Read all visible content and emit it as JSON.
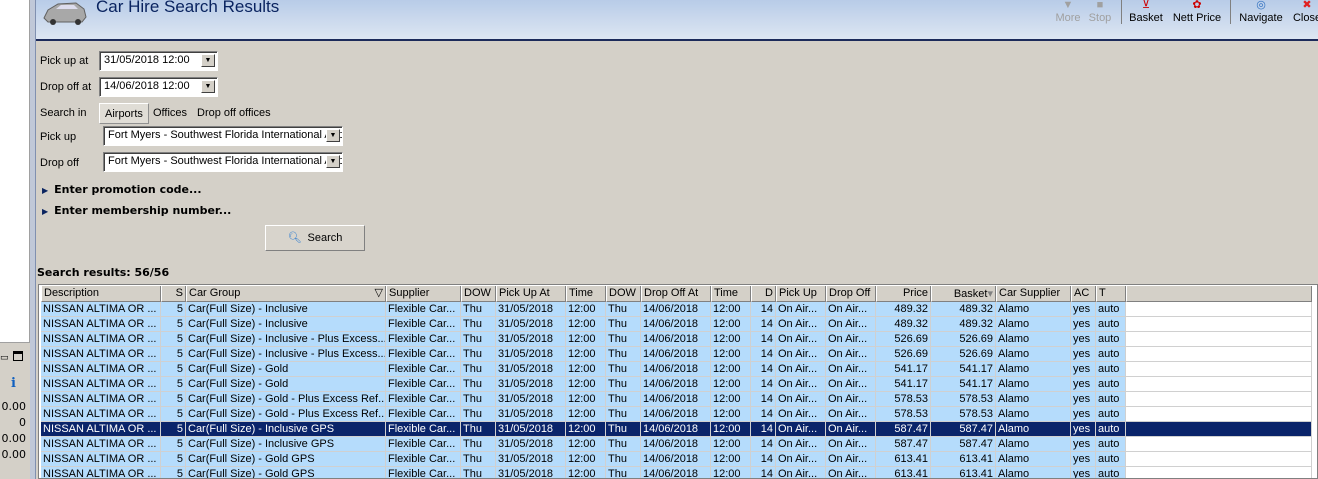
{
  "window": {
    "title": "Car Hire Search Results"
  },
  "toolbar": [
    {
      "label": "More",
      "icon": "more-icon",
      "enabled": false
    },
    {
      "label": "Stop",
      "icon": "stop-icon",
      "enabled": false
    },
    {
      "label": "Basket",
      "icon": "basket-icon",
      "enabled": true
    },
    {
      "label": "Nett Price",
      "icon": "nett-price-icon",
      "enabled": true
    },
    {
      "label": "Navigate",
      "icon": "navigate-icon",
      "enabled": true
    },
    {
      "label": "Close",
      "icon": "close-icon",
      "enabled": true
    }
  ],
  "form": {
    "pickup_at_label": "Pick up at",
    "pickup_at": "31/05/2018 12:00",
    "dropoff_at_label": "Drop off at",
    "dropoff_at": "14/06/2018 12:00",
    "search_in_label": "Search in",
    "search_in_tabs": [
      "Airports",
      "Offices",
      "Drop off offices"
    ],
    "pickup_label": "Pick up",
    "pickup": "Fort Myers - Southwest Florida International Airport",
    "dropoff_label": "Drop off",
    "dropoff": "Fort Myers - Southwest Florida International Airport",
    "promo": "Enter promotion code...",
    "membership": "Enter membership number...",
    "search_button": "Search"
  },
  "results": {
    "summary": "Search results: 56/56",
    "columns": [
      "Description",
      "S",
      "Car Group",
      "Supplier",
      "DOW",
      "Pick Up At",
      "Time",
      "DOW",
      "Drop Off At",
      "Time",
      "D",
      "Pick Up",
      "Drop Off",
      "Price",
      "Basket",
      "Car Supplier",
      "AC",
      "T"
    ],
    "selected_index": 8,
    "rows": [
      [
        "NISSAN ALTIMA OR ...",
        "5",
        "Car(Full Size) - Inclusive",
        "Flexible Car...",
        "Thu",
        "31/05/2018",
        "12:00",
        "Thu",
        "14/06/2018",
        "12:00",
        "14",
        "On Air...",
        "On Air...",
        "489.32",
        "489.32",
        "Alamo",
        "yes",
        "auto"
      ],
      [
        "NISSAN ALTIMA OR ...",
        "5",
        "Car(Full Size) - Inclusive",
        "Flexible Car...",
        "Thu",
        "31/05/2018",
        "12:00",
        "Thu",
        "14/06/2018",
        "12:00",
        "14",
        "On Air...",
        "On Air...",
        "489.32",
        "489.32",
        "Alamo",
        "yes",
        "auto"
      ],
      [
        "NISSAN ALTIMA OR ...",
        "5",
        "Car(Full Size) - Inclusive - Plus Excess...",
        "Flexible Car...",
        "Thu",
        "31/05/2018",
        "12:00",
        "Thu",
        "14/06/2018",
        "12:00",
        "14",
        "On Air...",
        "On Air...",
        "526.69",
        "526.69",
        "Alamo",
        "yes",
        "auto"
      ],
      [
        "NISSAN ALTIMA OR ...",
        "5",
        "Car(Full Size) - Inclusive - Plus Excess...",
        "Flexible Car...",
        "Thu",
        "31/05/2018",
        "12:00",
        "Thu",
        "14/06/2018",
        "12:00",
        "14",
        "On Air...",
        "On Air...",
        "526.69",
        "526.69",
        "Alamo",
        "yes",
        "auto"
      ],
      [
        "NISSAN ALTIMA OR ...",
        "5",
        "Car(Full Size) - Gold",
        "Flexible Car...",
        "Thu",
        "31/05/2018",
        "12:00",
        "Thu",
        "14/06/2018",
        "12:00",
        "14",
        "On Air...",
        "On Air...",
        "541.17",
        "541.17",
        "Alamo",
        "yes",
        "auto"
      ],
      [
        "NISSAN ALTIMA OR ...",
        "5",
        "Car(Full Size) - Gold",
        "Flexible Car...",
        "Thu",
        "31/05/2018",
        "12:00",
        "Thu",
        "14/06/2018",
        "12:00",
        "14",
        "On Air...",
        "On Air...",
        "541.17",
        "541.17",
        "Alamo",
        "yes",
        "auto"
      ],
      [
        "NISSAN ALTIMA OR ...",
        "5",
        "Car(Full Size) - Gold - Plus Excess Ref...",
        "Flexible Car...",
        "Thu",
        "31/05/2018",
        "12:00",
        "Thu",
        "14/06/2018",
        "12:00",
        "14",
        "On Air...",
        "On Air...",
        "578.53",
        "578.53",
        "Alamo",
        "yes",
        "auto"
      ],
      [
        "NISSAN ALTIMA OR ...",
        "5",
        "Car(Full Size) - Gold - Plus Excess Ref...",
        "Flexible Car...",
        "Thu",
        "31/05/2018",
        "12:00",
        "Thu",
        "14/06/2018",
        "12:00",
        "14",
        "On Air...",
        "On Air...",
        "578.53",
        "578.53",
        "Alamo",
        "yes",
        "auto"
      ],
      [
        "NISSAN ALTIMA OR ...",
        "5",
        "Car(Full Size) - Inclusive GPS",
        "Flexible Car...",
        "Thu",
        "31/05/2018",
        "12:00",
        "Thu",
        "14/06/2018",
        "12:00",
        "14",
        "On Air...",
        "On Air...",
        "587.47",
        "587.47",
        "Alamo",
        "yes",
        "auto"
      ],
      [
        "NISSAN ALTIMA OR ...",
        "5",
        "Car(Full Size) - Inclusive GPS",
        "Flexible Car...",
        "Thu",
        "31/05/2018",
        "12:00",
        "Thu",
        "14/06/2018",
        "12:00",
        "14",
        "On Air...",
        "On Air...",
        "587.47",
        "587.47",
        "Alamo",
        "yes",
        "auto"
      ],
      [
        "NISSAN ALTIMA OR ...",
        "5",
        "Car(Full Size) - Gold GPS",
        "Flexible Car...",
        "Thu",
        "31/05/2018",
        "12:00",
        "Thu",
        "14/06/2018",
        "12:00",
        "14",
        "On Air...",
        "On Air...",
        "613.41",
        "613.41",
        "Alamo",
        "yes",
        "auto"
      ],
      [
        "NISSAN ALTIMA OR ...",
        "5",
        "Car(Full Size) - Gold GPS",
        "Flexible Car...",
        "Thu",
        "31/05/2018",
        "12:00",
        "Thu",
        "14/06/2018",
        "12:00",
        "14",
        "On Air...",
        "On Air...",
        "613.41",
        "613.41",
        "Alamo",
        "yes",
        "auto"
      ]
    ]
  },
  "side_panel": {
    "values": [
      "0.00",
      "0",
      "0.00",
      "0.00"
    ]
  }
}
